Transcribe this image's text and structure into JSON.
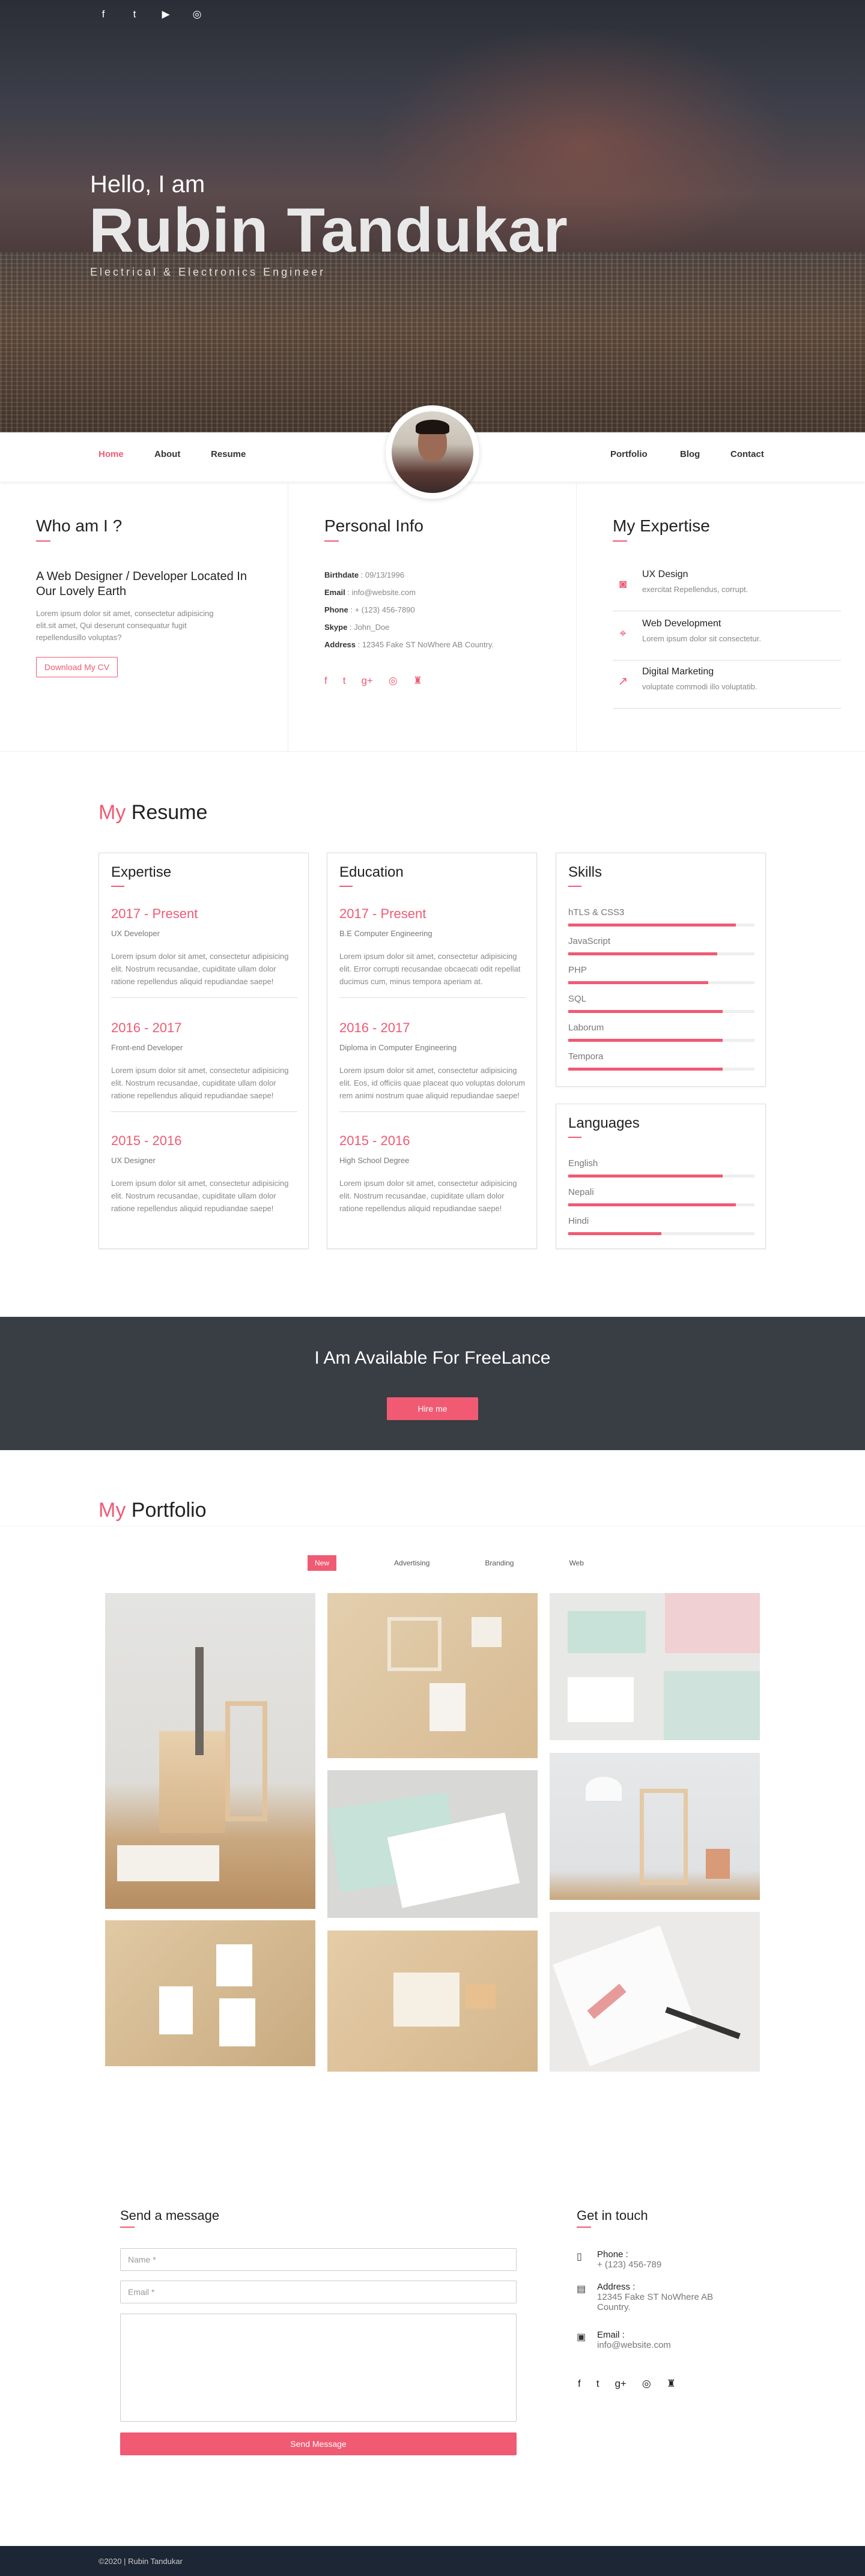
{
  "hero": {
    "social": [
      "f",
      "t",
      "▶",
      "◎"
    ],
    "hello": "Hello, I am",
    "name": "Rubin Tandukar",
    "subtitle": "Electrical & Electronics Engineer"
  },
  "nav": {
    "left": [
      "Home",
      "About",
      "Resume"
    ],
    "right": [
      "Portfolio",
      "Blog",
      "Contact"
    ]
  },
  "about": {
    "who_title": "Who am I ?",
    "who_heading": "A Web Designer / Developer Located In Our Lovely Earth",
    "who_text": "Lorem ipsum dolor sit amet, consectetur adipisicing elit.sit amet, Qui deserunt consequatur fugit repellendusillo voluptas?",
    "download": "Download My CV",
    "info_title": "Personal Info",
    "info": [
      {
        "k": "Birthdate",
        "v": " : 09/13/1996"
      },
      {
        "k": "Email",
        "v": " : info@website.com"
      },
      {
        "k": "Phone",
        "v": " : + (123) 456-7890"
      },
      {
        "k": "Skype",
        "v": " : John_Doe"
      },
      {
        "k": "Address",
        "v": " : 12345 Fake ST NoWhere AB Country."
      }
    ],
    "info_social": [
      "f",
      "t",
      "g+",
      "◎",
      "♜"
    ],
    "expertise_title": "My Expertise",
    "expertise": [
      {
        "icon": "◙",
        "title": "UX Design",
        "desc": "exercitat Repellendus, corrupt."
      },
      {
        "icon": "⌖",
        "title": "Web Development",
        "desc": "Lorem ipsum dolor sit consectetur."
      },
      {
        "icon": "↗",
        "title": "Digital Marketing",
        "desc": "voluptate commodi illo voluptatib."
      }
    ]
  },
  "resume": {
    "title_my": "My",
    "title": " Resume",
    "expertise_title": "Expertise",
    "expertise": [
      {
        "year": "2017 - Present",
        "role": "UX Developer",
        "text": "Lorem ipsum dolor sit amet, consectetur adipisicing elit. Nostrum recusandae, cupiditate ullam dolor ratione repellendus aliquid repudiandae saepe!"
      },
      {
        "year": "2016 - 2017",
        "role": "Front-end Developer",
        "text": "Lorem ipsum dolor sit amet, consectetur adipisicing elit. Nostrum recusandae, cupiditate ullam dolor ratione repellendus aliquid repudiandae saepe!"
      },
      {
        "year": "2015 - 2016",
        "role": "UX Designer",
        "text": "Lorem ipsum dolor sit amet, consectetur adipisicing elit. Nostrum recusandae, cupiditate ullam dolor ratione repellendus aliquid repudiandae saepe!"
      }
    ],
    "education_title": "Education",
    "education": [
      {
        "year": "2017 - Present",
        "role": "B.E Computer Engineering",
        "text": "Lorem ipsum dolor sit amet, consectetur adipisicing elit. Error corrupti recusandae obcaecati odit repellat ducimus cum, minus tempora aperiam at."
      },
      {
        "year": "2016 - 2017",
        "role": "Diploma in Computer Engineering",
        "text": "Lorem ipsum dolor sit amet, consectetur adipisicing elit. Eos, id officiis quae placeat quo voluptas dolorum rem animi nostrum quae aliquid repudiandae saepe!"
      },
      {
        "year": "2015 - 2016",
        "role": "High School Degree",
        "text": "Lorem ipsum dolor sit amet, consectetur adipisicing elit. Nostrum recusandae, cupiditate ullam dolor ratione repellendus aliquid repudiandae saepe!"
      }
    ],
    "skills_title": "Skills",
    "skills": [
      {
        "name": "hTLS & CSS3",
        "level": 0.9
      },
      {
        "name": "JavaScript",
        "level": 0.8
      },
      {
        "name": "PHP",
        "level": 0.75
      },
      {
        "name": "SQL",
        "level": 0.83
      },
      {
        "name": "Laborum",
        "level": 0.83
      },
      {
        "name": "Tempora",
        "level": 0.83
      }
    ],
    "languages_title": "Languages",
    "languages": [
      {
        "name": "English",
        "level": 0.83
      },
      {
        "name": "Nepali",
        "level": 0.9
      },
      {
        "name": "Hindi",
        "level": 0.5
      }
    ]
  },
  "freelance": {
    "title": "I Am Available For FreeLance",
    "button": "Hire me"
  },
  "portfolio": {
    "title_my": "My",
    "title": " Portfolio",
    "filters": [
      "New",
      "Advertising",
      "Branding",
      "Web"
    ]
  },
  "contact": {
    "send_title": "Send a message",
    "name_placeholder": "Name *",
    "email_placeholder": "Email *",
    "send_button": "Send Message",
    "touch_title": "Get in touch",
    "phone_label": "Phone :",
    "phone": "+ (123) 456-789",
    "address_label": "Address :",
    "address": "12345 Fake ST NoWhere AB Country.",
    "email_label": "Email :",
    "email": "info@website.com",
    "social": [
      "f",
      "t",
      "g+",
      "◎",
      "♜"
    ]
  },
  "footer": {
    "text": "©2020 | Rubin Tandukar"
  }
}
